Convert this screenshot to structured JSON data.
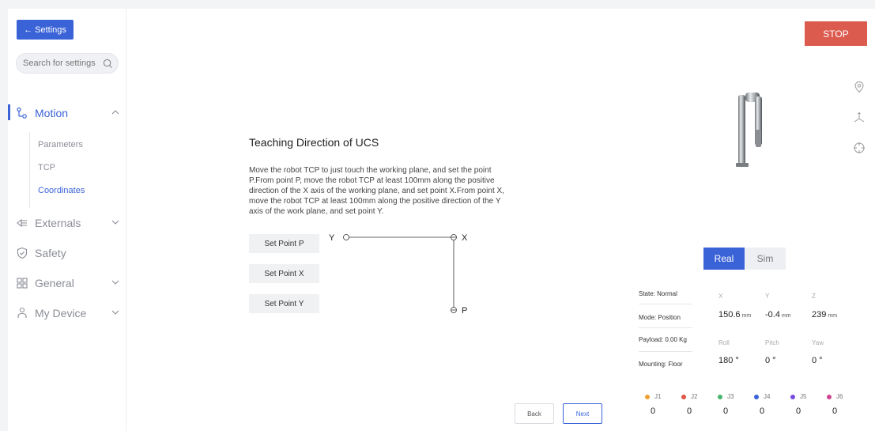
{
  "sidebar": {
    "back_label": "← Settings",
    "search_placeholder": "Search for settings",
    "items": [
      {
        "label": "Motion"
      },
      {
        "label": "Externals"
      },
      {
        "label": "Safety"
      },
      {
        "label": "General"
      },
      {
        "label": "My Device"
      }
    ],
    "motion_sub": [
      {
        "label": "Parameters"
      },
      {
        "label": "TCP"
      },
      {
        "label": "Coordinates"
      }
    ]
  },
  "main": {
    "title": "Teaching Direction of UCS",
    "description": "Move the robot TCP to just touch the working plane, and set the point P.From point P, move the robot TCP at least 100mm along the positive direction of the X axis of the working plane, and set point X.From point X, move the robot TCP at least 100mm along the positive direction of the Y axis of the work plane, and set point Y.",
    "buttons": {
      "set_p": "Set Point P",
      "set_x": "Set Point X",
      "set_y": "Set Point Y"
    },
    "diagram": {
      "y": "Y",
      "x": "X",
      "p": "P"
    },
    "back": "Back",
    "next": "Next"
  },
  "right": {
    "stop": "STOP",
    "mode_toggle": {
      "real": "Real",
      "sim": "Sim",
      "selected": "Real"
    },
    "info": {
      "state": "State: Normal",
      "mode": "Mode: Position",
      "payload": "Payload: 0.00 Kg",
      "mounting": "Mounting: Floor"
    },
    "position": {
      "x_label": "X",
      "y_label": "Y",
      "z_label": "Z",
      "x": "150.6",
      "y": "-0.4",
      "z": "239",
      "unit": "mm"
    },
    "orientation": {
      "roll_label": "Roll",
      "pitch_label": "Pitch",
      "yaw_label": "Yaw",
      "roll": "180 °",
      "pitch": "0 °",
      "yaw": "0 °"
    },
    "joints": [
      {
        "name": "J1",
        "value": "0",
        "color": "#f0a030"
      },
      {
        "name": "J2",
        "value": "0",
        "color": "#e05545"
      },
      {
        "name": "J3",
        "value": "0",
        "color": "#45b36a"
      },
      {
        "name": "J4",
        "value": "0",
        "color": "#3b63d8"
      },
      {
        "name": "J5",
        "value": "0",
        "color": "#7a4be0"
      },
      {
        "name": "J6",
        "value": "0",
        "color": "#d0458f"
      }
    ],
    "icons": [
      "location-pin-icon",
      "axes-icon",
      "crosshair-icon"
    ]
  },
  "colors": {
    "accent": "#3b63d8",
    "stop": "#dc5b4f"
  }
}
